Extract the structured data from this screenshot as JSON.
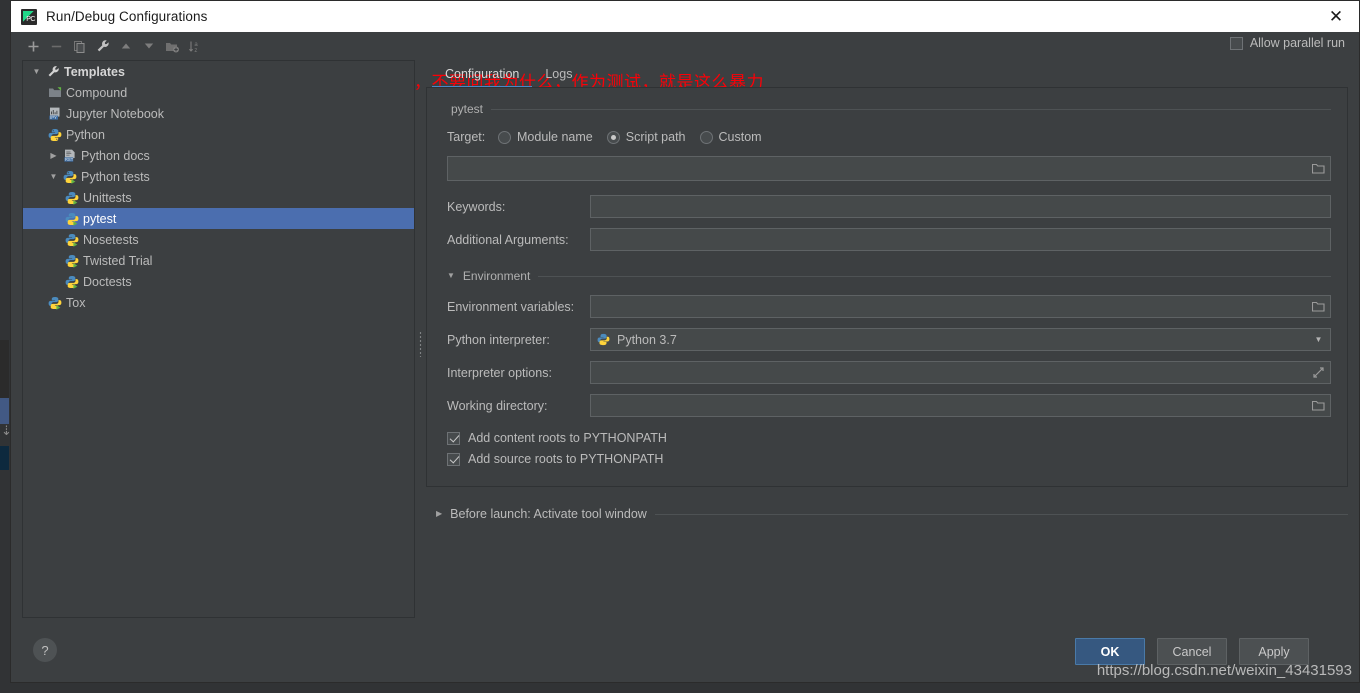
{
  "window": {
    "title": "Run/Debug Configurations",
    "app_icon": "pycharm-icon",
    "close_label": "✕"
  },
  "toolbar": {
    "buttons": [
      {
        "name": "add-button",
        "label": "+"
      },
      {
        "name": "remove-button",
        "label": "−"
      },
      {
        "name": "copy-button",
        "label": "copy-icon"
      },
      {
        "name": "edit-templates-button",
        "label": "wrench-icon"
      },
      {
        "name": "move-up-button",
        "label": "▲"
      },
      {
        "name": "move-down-button",
        "label": "▼"
      },
      {
        "name": "move-into-folder-button",
        "label": "folder-add-icon"
      },
      {
        "name": "sort-button",
        "label": "sort-alpha-icon"
      }
    ],
    "allow_parallel_run": {
      "label": "Allow parallel run",
      "checked": false
    }
  },
  "annotation": {
    "text": "全部干掉，不要问我为什么，作为测试，就是这么暴力",
    "color": "#fb0007",
    "arrow_color": "#fb0007"
  },
  "tree": {
    "items": [
      {
        "label": "Templates",
        "icon": "wrench-icon",
        "indent": 0,
        "twisty": "expanded",
        "bold": true,
        "selected": false
      },
      {
        "label": "Compound",
        "icon": "compound-folder-icon",
        "indent": 1,
        "twisty": "none",
        "bold": false,
        "selected": false
      },
      {
        "label": "Jupyter Notebook",
        "icon": "jupyter-icon",
        "indent": 1,
        "twisty": "none",
        "bold": false,
        "selected": false
      },
      {
        "label": "Python",
        "icon": "python-icon",
        "indent": 1,
        "twisty": "none",
        "bold": false,
        "selected": false
      },
      {
        "label": "Python docs",
        "icon": "rst-icon",
        "indent": 1,
        "twisty": "collapsed",
        "bold": false,
        "selected": false
      },
      {
        "label": "Python tests",
        "icon": "python-test-icon",
        "indent": 1,
        "twisty": "expanded",
        "bold": false,
        "selected": false
      },
      {
        "label": "Unittests",
        "icon": "python-test-icon",
        "indent": 2,
        "twisty": "none",
        "bold": false,
        "selected": false
      },
      {
        "label": "pytest",
        "icon": "python-test-icon",
        "indent": 2,
        "twisty": "none",
        "bold": false,
        "selected": true
      },
      {
        "label": "Nosetests",
        "icon": "python-test-icon",
        "indent": 2,
        "twisty": "none",
        "bold": false,
        "selected": false
      },
      {
        "label": "Twisted Trial",
        "icon": "python-test-icon",
        "indent": 2,
        "twisty": "none",
        "bold": false,
        "selected": false
      },
      {
        "label": "Doctests",
        "icon": "python-test-icon",
        "indent": 2,
        "twisty": "none",
        "bold": false,
        "selected": false
      },
      {
        "label": "Tox",
        "icon": "python-test-icon",
        "indent": 1,
        "twisty": "none",
        "bold": false,
        "selected": false
      }
    ]
  },
  "tabs": [
    {
      "label": "Configuration",
      "active": true
    },
    {
      "label": "Logs",
      "active": false
    }
  ],
  "config": {
    "group_label": "pytest",
    "target": {
      "label": "Target:",
      "options": [
        {
          "label": "Module name",
          "checked": false
        },
        {
          "label": "Script path",
          "checked": true
        },
        {
          "label": "Custom",
          "checked": false
        }
      ],
      "value": "",
      "browse_icon": "folder-icon"
    },
    "keywords": {
      "label": "Keywords:",
      "value": ""
    },
    "additional_arguments": {
      "label": "Additional Arguments:",
      "value": ""
    },
    "environment": {
      "group_label": "Environment",
      "expanded": true,
      "environment_variables": {
        "label": "Environment variables:",
        "value": "",
        "browse_icon": "folder-icon"
      },
      "python_interpreter": {
        "label": "Python interpreter:",
        "value": "Python 3.7",
        "icon": "python-icon",
        "arrow": "▼"
      },
      "interpreter_options": {
        "label": "Interpreter options:",
        "value": "",
        "expand_icon": "expand-icon"
      },
      "working_directory": {
        "label": "Working directory:",
        "value": "",
        "browse_icon": "folder-icon"
      },
      "checkboxes": [
        {
          "label": "Add content roots to PYTHONPATH",
          "checked": true
        },
        {
          "label": "Add source roots to PYTHONPATH",
          "checked": true
        }
      ]
    }
  },
  "before_launch": {
    "label": "Before launch: Activate tool window",
    "expanded": false
  },
  "footer": {
    "help_label": "?",
    "buttons": [
      {
        "name": "ok-button",
        "label": "OK",
        "primary": true
      },
      {
        "name": "cancel-button",
        "label": "Cancel",
        "primary": false
      },
      {
        "name": "apply-button",
        "label": "Apply",
        "primary": false
      }
    ]
  },
  "watermark": {
    "text": "https://blog.csdn.net/weixin_43431593"
  },
  "colors": {
    "dialog_bg": "#3c3f41",
    "selection": "#4b6eaf",
    "accent_tab": "#4a88c7",
    "primary_button": "#365880",
    "annotation_red": "#fb0007",
    "field_bg": "#45494a"
  }
}
